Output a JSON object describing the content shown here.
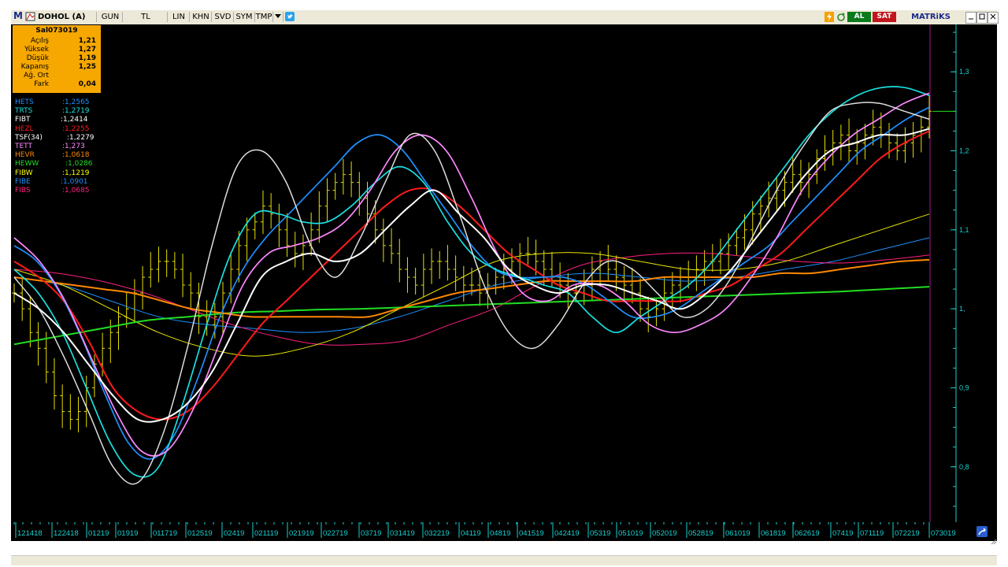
{
  "toolbar": {
    "app_icon": "M",
    "symbol": "DOHOL (A)",
    "period": "GUN",
    "currency": "TL",
    "scale": "LIN",
    "khn": "KHN",
    "svd": "SVD",
    "sym": "SYM",
    "tmp": "TMP",
    "al_label": "AL",
    "sat_label": "SAT",
    "brand": "MATRiKS",
    "icons": [
      "flag-icon",
      "dropdown-icon",
      "twitter-icon",
      "lightning-icon",
      "refresh-icon",
      "minimize-icon",
      "restore-icon",
      "close-icon"
    ]
  },
  "info_box": {
    "title": "Sal073019",
    "rows": [
      {
        "label": "Açılış",
        "value": "1,21"
      },
      {
        "label": "Yüksek",
        "value": "1,27"
      },
      {
        "label": "Düşük",
        "value": "1,19"
      },
      {
        "label": "Kapanış",
        "value": "1,25"
      },
      {
        "label": "Ağ. Ort",
        "value": ""
      },
      {
        "label": "Fark",
        "value": "0,04"
      }
    ]
  },
  "legend": [
    {
      "name": "HETS",
      "value": ":1,2565",
      "color": "#1e90ff"
    },
    {
      "name": "TRTS",
      "value": ":1,2719",
      "color": "#19e0e0"
    },
    {
      "name": "FIBT",
      "value": ":1,2414",
      "color": "#ffffff"
    },
    {
      "name": "HEZL",
      "value": ":1,2255",
      "color": "#ff1a1a"
    },
    {
      "name": "TSF(34)",
      "value": ":1,2279",
      "color": "#ffffff"
    },
    {
      "name": "TETT",
      "value": ":1,273",
      "color": "#ff88ff"
    },
    {
      "name": "HEVR",
      "value": ":1,0618",
      "color": "#ff8800"
    },
    {
      "name": "HEWW",
      "value": ":1,0286",
      "color": "#22dd22"
    },
    {
      "name": "FIBW",
      "value": ":1,1219",
      "color": "#ffff00"
    },
    {
      "name": "FIBE",
      "value": ":1,0901",
      "color": "#1e90ff"
    },
    {
      "name": "FIBS",
      "value": ":1,0685",
      "color": "#ff2080"
    }
  ],
  "chart_data": {
    "type": "line",
    "ylim": [
      0.73,
      1.36
    ],
    "yticks": [
      {
        "value": 1.3,
        "label": "1,3"
      },
      {
        "value": 1.2,
        "label": "1,2"
      },
      {
        "value": 1.1,
        "label": "1,1"
      },
      {
        "value": 1.0,
        "label": "1,"
      },
      {
        "value": 0.9,
        "label": "0,9"
      },
      {
        "value": 0.8,
        "label": "0,8"
      }
    ],
    "x_tick_labels": [
      "121418",
      "122418",
      "01219",
      "01919",
      "011719",
      "012519",
      "02419",
      "021119",
      "021919",
      "022719",
      "03719",
      "031419",
      "032219",
      "04119",
      "04819",
      "041519",
      "042419",
      "05319",
      "051019",
      "052019",
      "052819",
      "061019",
      "061819",
      "062619",
      "07419",
      "071119",
      "072219",
      "073019"
    ],
    "bars_count": 156,
    "price": [
      1.02,
      1.0,
      0.97,
      0.95,
      0.92,
      0.89,
      0.87,
      0.86,
      0.87,
      0.9,
      0.93,
      0.95,
      0.97,
      0.99,
      1.0,
      1.02,
      1.04,
      1.05,
      1.06,
      1.06,
      1.05,
      1.03,
      1.02,
      0.99,
      0.98,
      0.99,
      1.02,
      1.05,
      1.08,
      1.1,
      1.11,
      1.13,
      1.12,
      1.1,
      1.08,
      1.07,
      1.08,
      1.1,
      1.13,
      1.15,
      1.16,
      1.17,
      1.16,
      1.14,
      1.12,
      1.1,
      1.08,
      1.07,
      1.05,
      1.04,
      1.03,
      1.05,
      1.06,
      1.06,
      1.05,
      1.04,
      1.03,
      1.03,
      1.02,
      1.03,
      1.04,
      1.05,
      1.06,
      1.07,
      1.07,
      1.06,
      1.05,
      1.04,
      1.03,
      1.02,
      1.02,
      1.03,
      1.05,
      1.06,
      1.05,
      1.04,
      1.03,
      1.02,
      1.0,
      0.99,
      1.0,
      1.02,
      1.03,
      1.04,
      1.04,
      1.05,
      1.06,
      1.06,
      1.07,
      1.08,
      1.09,
      1.1,
      1.12,
      1.13,
      1.14,
      1.15,
      1.16,
      1.17,
      1.16,
      1.17,
      1.19,
      1.2,
      1.21,
      1.22,
      1.2,
      1.21,
      1.22,
      1.23,
      1.22,
      1.21,
      1.2,
      1.21,
      1.22,
      1.23,
      1.25
    ],
    "series": [
      {
        "name": "HETS",
        "color": "#1e90ff",
        "width": 1.7,
        "values": [
          1.08,
          1.06,
          1.02,
          0.96,
          0.89,
          0.83,
          0.81,
          0.84,
          0.91,
          0.99,
          1.05,
          1.09,
          1.12,
          1.15,
          1.18,
          1.21,
          1.22,
          1.2,
          1.16,
          1.12,
          1.08,
          1.05,
          1.04,
          1.04,
          1.04,
          1.03,
          1.01,
          0.99,
          0.99,
          1.0,
          1.02,
          1.04,
          1.06,
          1.08,
          1.11,
          1.14,
          1.17,
          1.2,
          1.22,
          1.24,
          1.255
        ]
      },
      {
        "name": "TRTS",
        "color": "#19e0e0",
        "width": 1.7,
        "values": [
          1.05,
          1.02,
          0.97,
          0.9,
          0.83,
          0.79,
          0.8,
          0.88,
          0.98,
          1.07,
          1.12,
          1.12,
          1.11,
          1.11,
          1.13,
          1.16,
          1.18,
          1.16,
          1.11,
          1.07,
          1.05,
          1.04,
          1.03,
          1.02,
          0.99,
          0.97,
          0.99,
          1.01,
          1.03,
          1.06,
          1.1,
          1.14,
          1.18,
          1.22,
          1.25,
          1.27,
          1.28,
          1.28,
          1.27
        ]
      },
      {
        "name": "FIBT",
        "color": "#dddddd",
        "width": 1.5,
        "values": [
          1.04,
          1.0,
          0.94,
          0.87,
          0.8,
          0.78,
          0.84,
          0.95,
          1.08,
          1.18,
          1.2,
          1.16,
          1.08,
          1.04,
          1.09,
          1.16,
          1.22,
          1.2,
          1.12,
          1.03,
          0.97,
          0.95,
          0.98,
          1.03,
          1.06,
          1.05,
          1.02,
          0.99,
          1.0,
          1.04,
          1.1,
          1.16,
          1.21,
          1.25,
          1.26,
          1.26,
          1.25,
          1.24
        ]
      },
      {
        "name": "HEZL",
        "color": "#ff1a1a",
        "width": 2.0,
        "values": [
          1.06,
          1.04,
          1.01,
          0.96,
          0.9,
          0.87,
          0.86,
          0.87,
          0.9,
          0.94,
          0.98,
          1.01,
          1.04,
          1.07,
          1.1,
          1.13,
          1.15,
          1.15,
          1.13,
          1.1,
          1.07,
          1.05,
          1.03,
          1.02,
          1.01,
          1.01,
          1.01,
          1.01,
          1.02,
          1.03,
          1.05,
          1.07,
          1.1,
          1.13,
          1.16,
          1.19,
          1.21,
          1.225
        ]
      },
      {
        "name": "TSF(34)",
        "color": "#ffffff",
        "width": 2.0,
        "values": [
          1.02,
          1.0,
          0.97,
          0.93,
          0.89,
          0.86,
          0.86,
          0.88,
          0.92,
          0.98,
          1.04,
          1.06,
          1.07,
          1.06,
          1.07,
          1.1,
          1.13,
          1.15,
          1.12,
          1.09,
          1.05,
          1.03,
          1.02,
          1.03,
          1.03,
          1.02,
          1.01,
          1.0,
          1.02,
          1.05,
          1.09,
          1.13,
          1.17,
          1.2,
          1.21,
          1.22,
          1.22,
          1.228
        ]
      },
      {
        "name": "TETT",
        "color": "#ff88ff",
        "width": 1.7,
        "values": [
          1.09,
          1.06,
          1.01,
          0.94,
          0.87,
          0.82,
          0.82,
          0.87,
          0.95,
          1.03,
          1.07,
          1.08,
          1.09,
          1.11,
          1.15,
          1.2,
          1.22,
          1.2,
          1.14,
          1.07,
          1.02,
          1.01,
          1.03,
          1.03,
          1.01,
          0.98,
          0.97,
          0.98,
          1.0,
          1.04,
          1.09,
          1.15,
          1.19,
          1.22,
          1.24,
          1.26,
          1.273
        ]
      },
      {
        "name": "HEVR",
        "color": "#ff8800",
        "width": 2.0,
        "values": [
          1.04,
          1.035,
          1.03,
          1.025,
          1.02,
          1.01,
          1.0,
          0.995,
          0.99,
          0.99,
          0.99,
          0.99,
          0.99,
          1.0,
          1.01,
          1.02,
          1.025,
          1.03,
          1.035,
          1.035,
          1.035,
          1.035,
          1.04,
          1.04,
          1.04,
          1.04,
          1.045,
          1.045,
          1.05,
          1.055,
          1.06,
          1.062
        ]
      },
      {
        "name": "HEWW",
        "color": "#22dd22",
        "width": 2.0,
        "values": [
          0.955,
          0.965,
          0.975,
          0.985,
          0.99,
          0.995,
          0.997,
          0.999,
          1.0,
          1.002,
          1.004,
          1.006,
          1.008,
          1.01,
          1.012,
          1.014,
          1.016,
          1.018,
          1.02,
          1.022,
          1.025,
          1.028
        ]
      },
      {
        "name": "FIBW",
        "color": "#e6e600",
        "width": 1.0,
        "values": [
          1.05,
          1.03,
          1.0,
          0.97,
          0.95,
          0.94,
          0.95,
          0.97,
          1.0,
          1.03,
          1.06,
          1.07,
          1.07,
          1.06,
          1.05,
          1.05,
          1.06,
          1.08,
          1.1,
          1.12
        ]
      },
      {
        "name": "FIBE",
        "color": "#1e90ff",
        "width": 1.0,
        "values": [
          1.04,
          1.03,
          1.01,
          0.99,
          0.98,
          0.975,
          0.97,
          0.975,
          0.99,
          1.01,
          1.03,
          1.04,
          1.045,
          1.04,
          1.035,
          1.04,
          1.05,
          1.06,
          1.075,
          1.09
        ]
      },
      {
        "name": "FIBS",
        "color": "#ff2080",
        "width": 1.0,
        "values": [
          1.05,
          1.045,
          1.035,
          1.02,
          1.0,
          0.98,
          0.965,
          0.955,
          0.955,
          0.96,
          0.98,
          1.0,
          1.03,
          1.055,
          1.065,
          1.07,
          1.07,
          1.065,
          1.06,
          1.058,
          1.062,
          1.068
        ]
      }
    ]
  }
}
